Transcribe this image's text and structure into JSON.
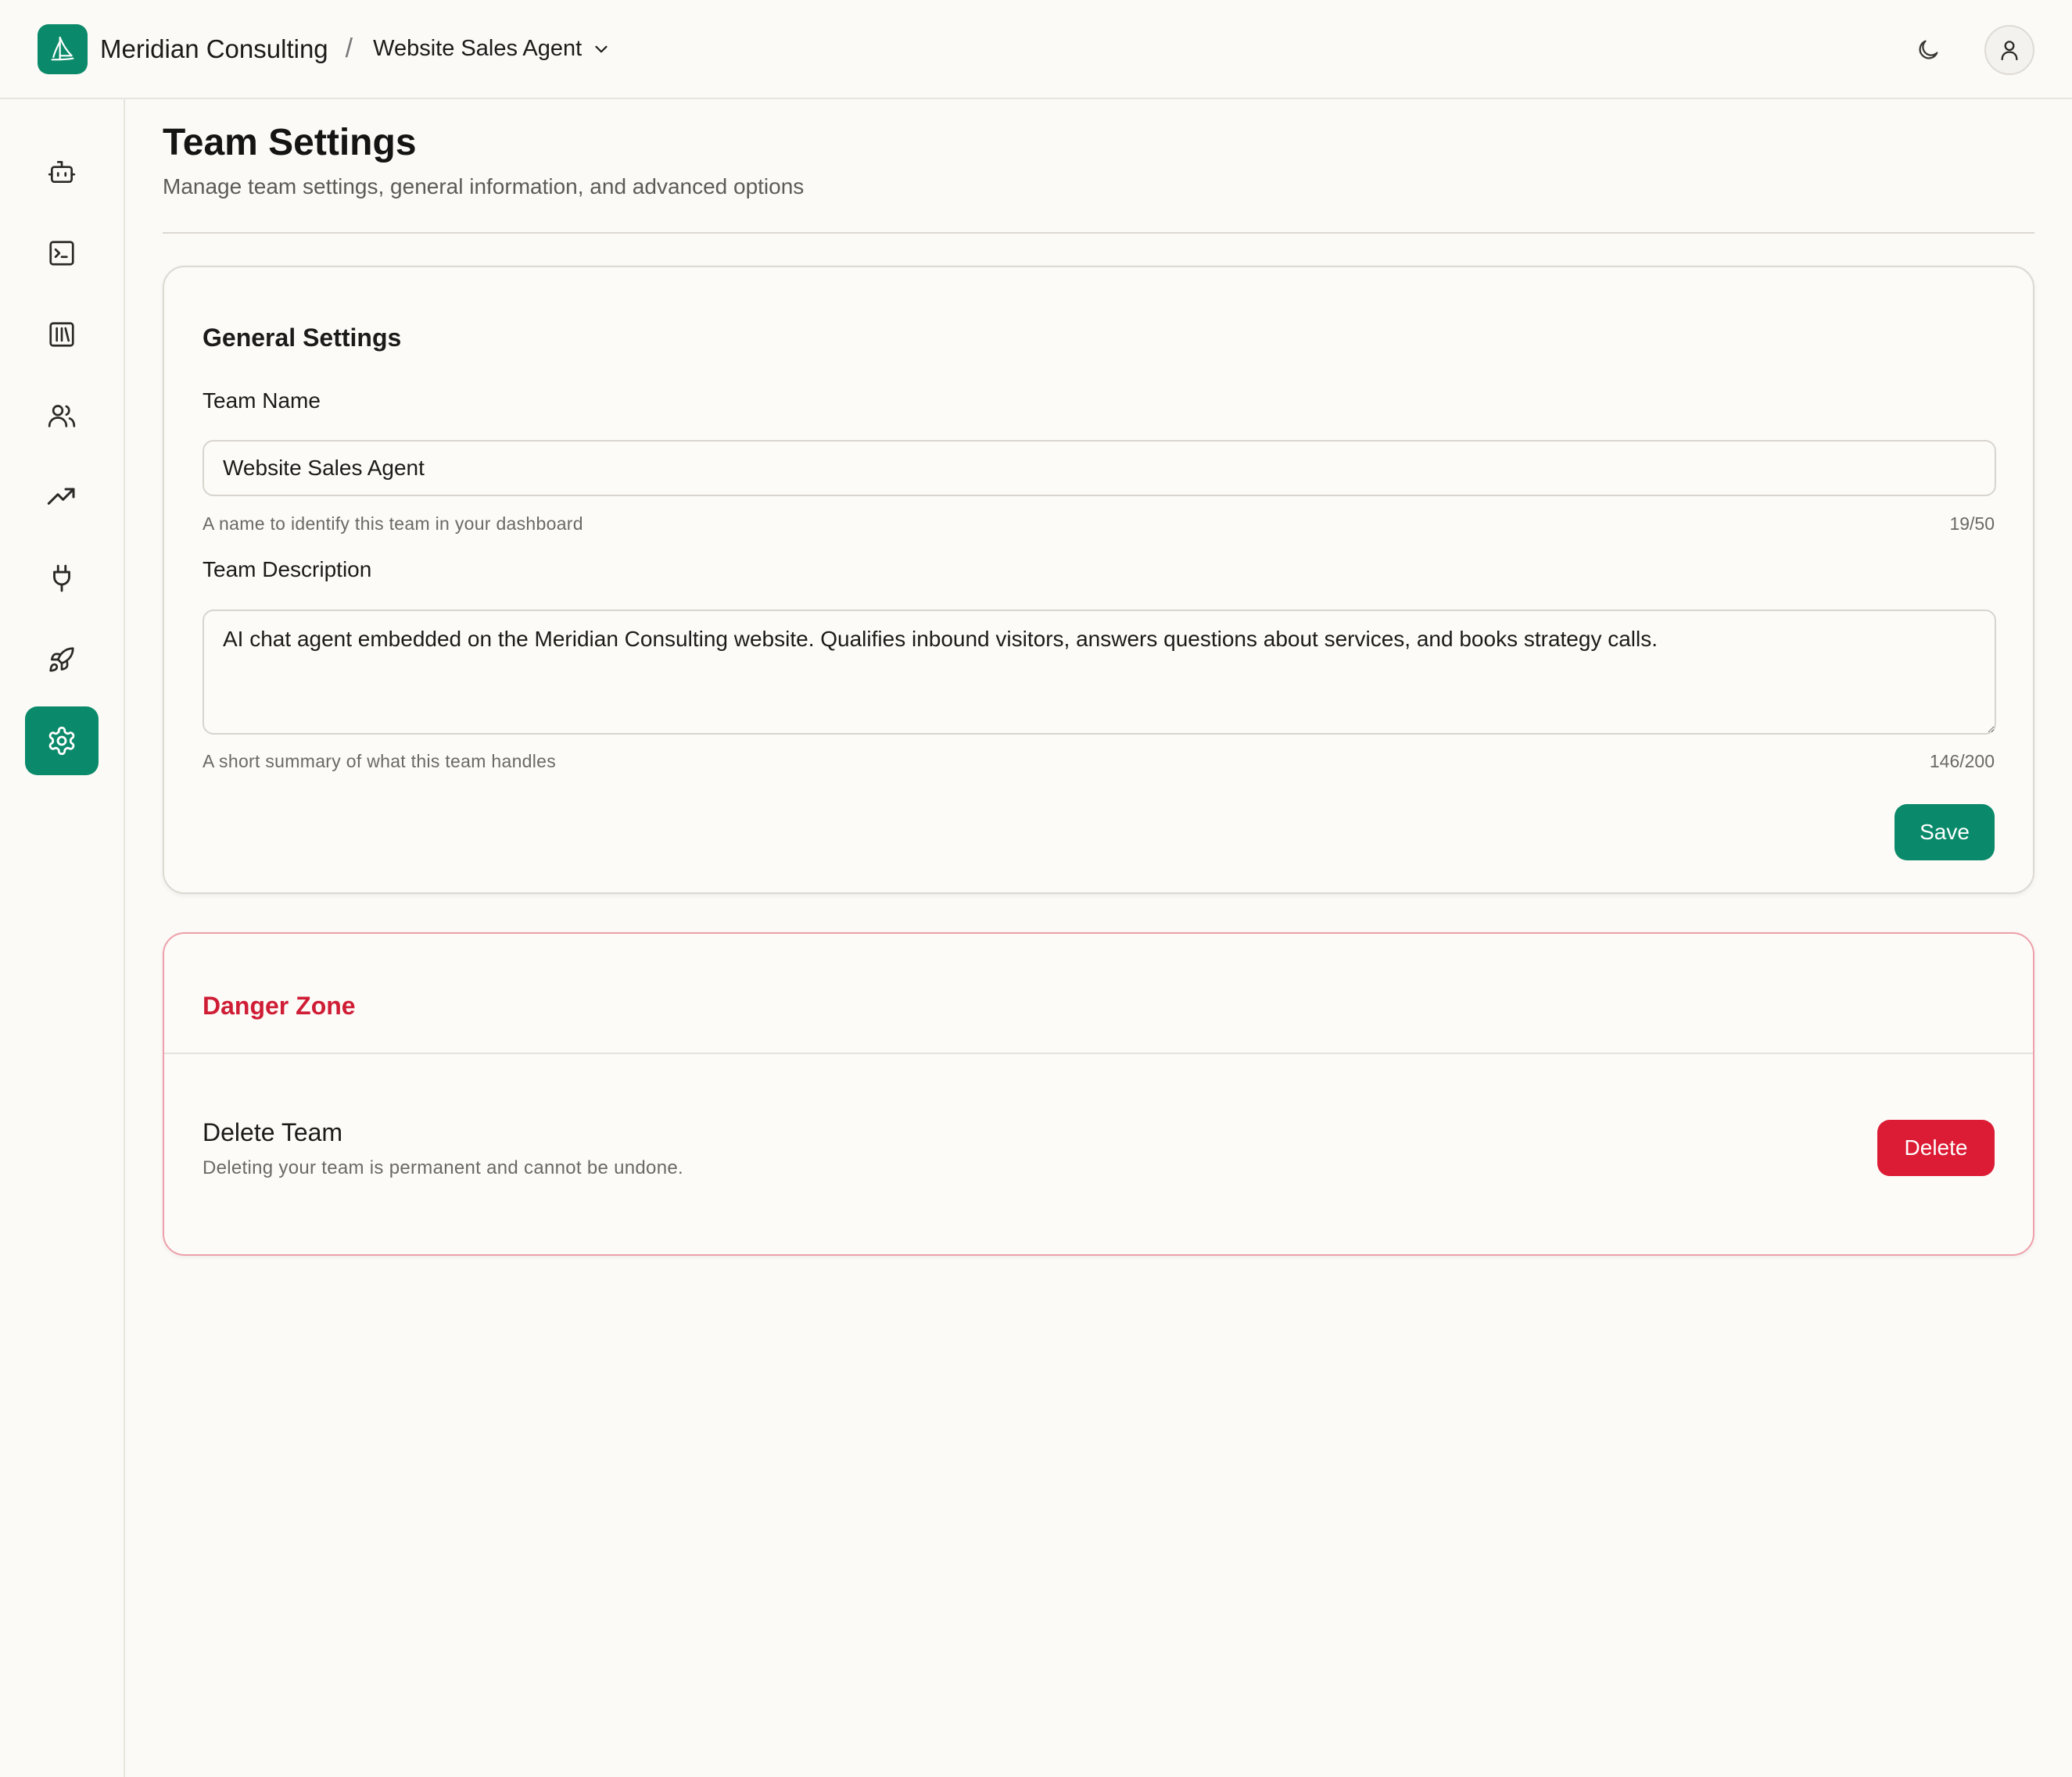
{
  "header": {
    "org_name": "Meridian Consulting",
    "separator": "/",
    "team_selector": "Website Sales Agent"
  },
  "sidebar": {
    "items": [
      {
        "icon": "bot-icon",
        "active": false
      },
      {
        "icon": "terminal-icon",
        "active": false
      },
      {
        "icon": "library-icon",
        "active": false
      },
      {
        "icon": "users-icon",
        "active": false
      },
      {
        "icon": "trending-up-icon",
        "active": false
      },
      {
        "icon": "plug-icon",
        "active": false
      },
      {
        "icon": "rocket-icon",
        "active": false
      },
      {
        "icon": "settings-icon",
        "active": true
      }
    ]
  },
  "page": {
    "title": "Team Settings",
    "subtitle": "Manage team settings, general information, and advanced options"
  },
  "general": {
    "section_title": "General Settings",
    "team_name_label": "Team Name",
    "team_name_value": "Website Sales Agent",
    "team_name_hint": "A name to identify this team in your dashboard",
    "team_name_count": "19/50",
    "team_desc_label": "Team Description",
    "team_desc_value": "AI chat agent embedded on the Meridian Consulting website. Qualifies inbound visitors, answers questions about services, and books strategy calls.",
    "team_desc_hint": "A short summary of what this team handles",
    "team_desc_count": "146/200",
    "save_label": "Save"
  },
  "danger": {
    "section_title": "Danger Zone",
    "delete_title": "Delete Team",
    "delete_description": "Deleting your team is permanent and cannot be undone.",
    "delete_label": "Delete"
  },
  "colors": {
    "brand": "#0a8a6a",
    "danger": "#dc1b34",
    "background": "#fcfaf7"
  }
}
